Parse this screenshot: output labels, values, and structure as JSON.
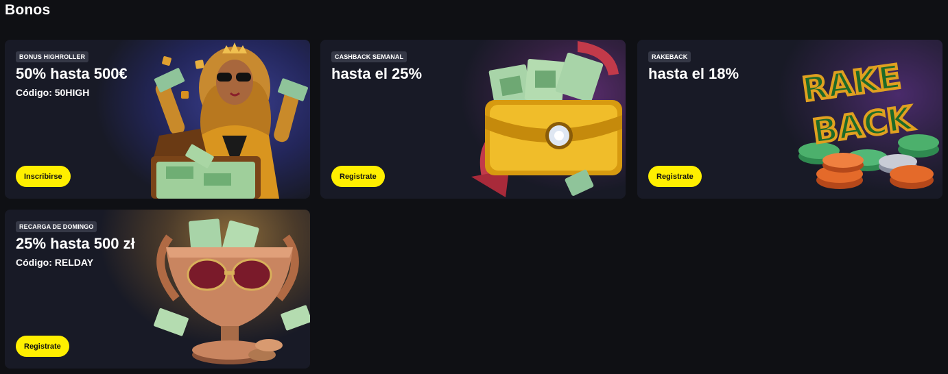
{
  "page": {
    "title": "Bonos"
  },
  "cards": [
    {
      "tag": "BONUS HIGHROLLER",
      "headline": "50% hasta 500€",
      "code": "Código: 50HIGH",
      "button": "Inscribirse",
      "art": "woman-with-money-suitcase-image"
    },
    {
      "tag": "CASHBACK SEMANAL",
      "headline": "hasta el 25%",
      "button": "Registrate",
      "art": "golden-wallet-with-cash-image"
    },
    {
      "tag": "RAKEBACK",
      "headline": "hasta el 18%",
      "button": "Registrate",
      "art": "rake-back-chips-image",
      "art_text_line1": "RAKE",
      "art_text_line2": "BACK"
    },
    {
      "tag": "RECARGA DE DOMINGO",
      "headline": "25% hasta 500 zł",
      "code": "Código: RELDAY",
      "button": "Registrate",
      "art": "bronze-trophy-with-sunglasses-image"
    }
  ],
  "colors": {
    "background": "#0f1014",
    "card": "#181a26",
    "button": "#ffef00",
    "tag": "#353846"
  }
}
